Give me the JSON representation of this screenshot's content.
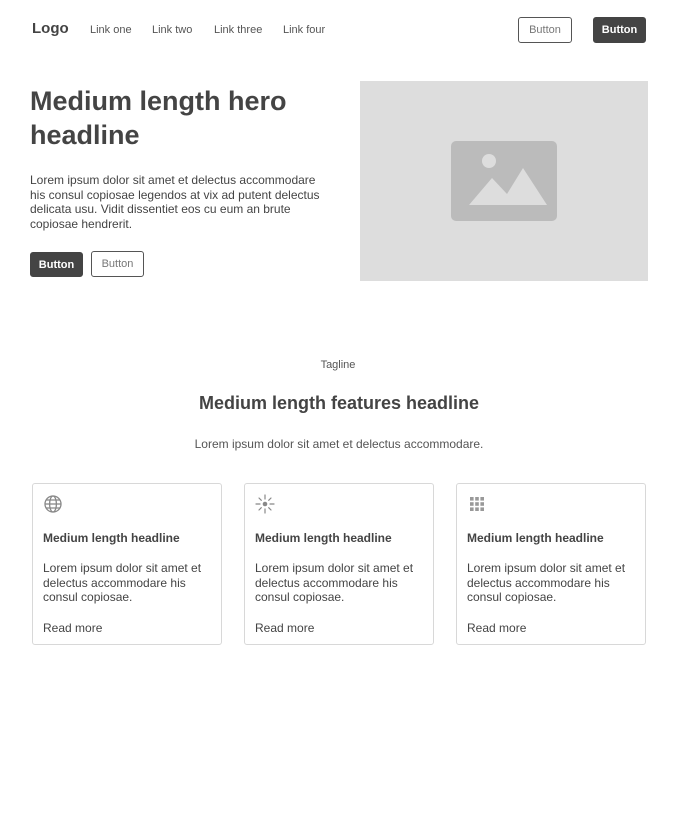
{
  "nav": {
    "logo": "Logo",
    "links": [
      "Link one",
      "Link two",
      "Link three",
      "Link four"
    ],
    "button_outline": "Button",
    "button_dark": "Button"
  },
  "hero": {
    "headline": "Medium length hero headline",
    "body": "Lorem ipsum dolor sit amet et delectus accommodare his consul copiosae legendos at vix ad putent delectus delicata usu. Vidit dissentiet eos cu eum an brute copiosae hendrerit.",
    "button_dark": "Button",
    "button_outline": "Button",
    "image_icon": "image-placeholder-icon"
  },
  "features": {
    "tagline": "Tagline",
    "headline": "Medium length features headline",
    "subtitle": "Lorem ipsum dolor sit amet et delectus accommodare.",
    "cards": [
      {
        "icon": "globe-icon",
        "title": "Medium length headline",
        "text": "Lorem ipsum dolor sit amet et delectus accommodare his consul copiosae.",
        "link": "Read more"
      },
      {
        "icon": "sparkle-icon",
        "title": "Medium length headline",
        "text": "Lorem ipsum dolor sit amet et delectus accommodare his consul copiosae.",
        "link": "Read more"
      },
      {
        "icon": "grid-icon",
        "title": "Medium length headline",
        "text": "Lorem ipsum dolor sit amet et delectus accommodare his consul copiosae.",
        "link": "Read more"
      }
    ]
  },
  "colors": {
    "text": "#444444",
    "dark_button": "#444444",
    "image_bg": "#dddddd",
    "image_icon": "#bbbbbb",
    "card_border": "#d8d8d8"
  }
}
